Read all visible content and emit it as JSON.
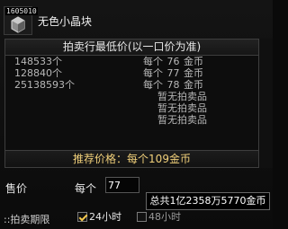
{
  "item": {
    "stack_count": "1605010",
    "name": "无色小晶块",
    "icon": "crystal-block-icon"
  },
  "price_table": {
    "header": "拍卖行最低价(以一口价为准)",
    "rows": [
      {
        "quantity": "148533个",
        "price": "每个 76 金币"
      },
      {
        "quantity": "128840个",
        "price": "每个 77 金币"
      },
      {
        "quantity": "25138593个",
        "price": "每个 78 金币"
      }
    ],
    "empty_rows": [
      "暂无拍卖品",
      "暂无拍卖品",
      "暂无拍卖品"
    ],
    "suggested_price": "推荐价格：每个109金币"
  },
  "sell": {
    "label": "售价",
    "per_unit_label": "每个",
    "price_value": "77",
    "total_tooltip": "总共1亿2358万5770金币"
  },
  "period": {
    "label": "::拍卖期限",
    "options": [
      {
        "label": "24小时",
        "checked": true
      },
      {
        "label": "48小时",
        "checked": false
      }
    ]
  },
  "colors": {
    "suggest_text": "#f1d07a",
    "background": "#0a0a0a",
    "border": "#3e3e3e"
  }
}
